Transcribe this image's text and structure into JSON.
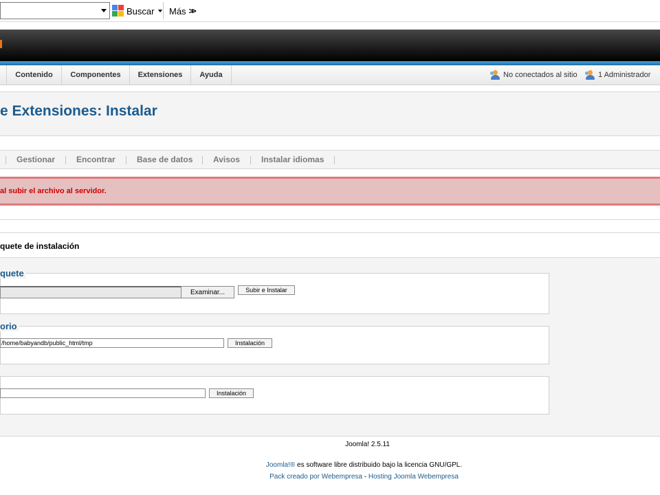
{
  "toolbar": {
    "search_button": "Buscar",
    "more_button": "Más"
  },
  "menu": {
    "items": [
      "Contenido",
      "Componentes",
      "Extensiones",
      "Ayuda"
    ],
    "status_online": "No conectados al sitio",
    "status_admin": "1 Administrador"
  },
  "page": {
    "title": "e Extensiones: Instalar"
  },
  "subnav": {
    "tabs": [
      "Gestionar",
      "Encontrar",
      "Base de datos",
      "Avisos",
      "Instalar idiomas"
    ]
  },
  "error": {
    "message": "al subir el archivo al servidor."
  },
  "package": {
    "header": "quete de instalación",
    "upload": {
      "legend": "quete",
      "browse_label": "Examinar...",
      "submit_label": "Subir e Instalar"
    },
    "directory": {
      "legend": "orio",
      "path_value": "/home/babyandb/public_html/tmp",
      "submit_label": "Instalación"
    },
    "url": {
      "url_value": "",
      "submit_label": "Instalación"
    }
  },
  "footer": {
    "version": "Joomla! 2.5.11",
    "license_link": "Joomla!®",
    "license_text": " es software libre distribuido bajo la licencia GNU/GPL.",
    "pack_link": "Pack creado por Webempresa",
    "separator": " - ",
    "hosting_link": "Hosting Joomla Webempresa"
  }
}
